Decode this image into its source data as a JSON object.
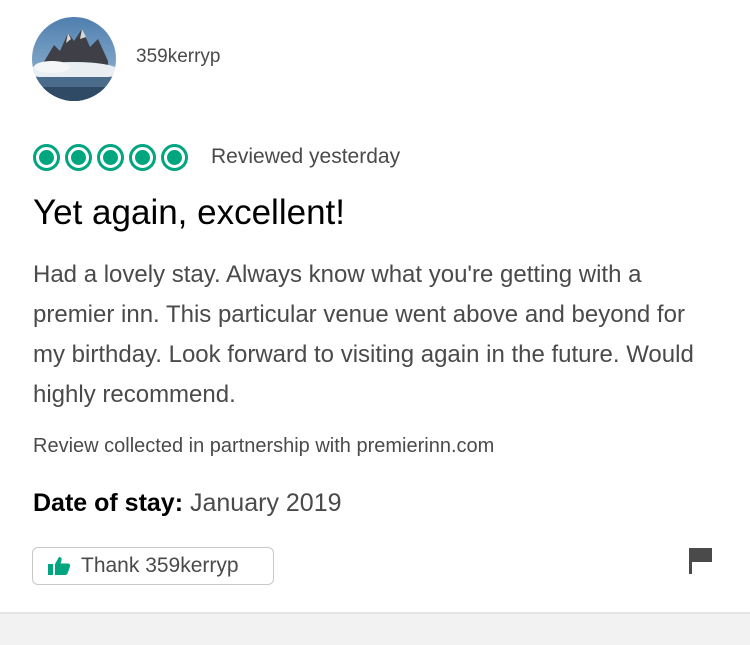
{
  "reviewer": {
    "username": "359kerryp",
    "avatar_icon": "mountain-landscape-avatar"
  },
  "review": {
    "rating": 5,
    "rating_max": 5,
    "rating_color": "#00a680",
    "date_text": "Reviewed yesterday",
    "title": "Yet again, excellent!",
    "body": "Had a lovely stay. Always know what you're getting with a premier inn. This particular venue went above and beyond for my birthday. Look forward to visiting again in the future. Would highly recommend.",
    "collected_text": "Review collected in partnership with premierinn.com",
    "stay_label": "Date of stay:",
    "stay_value": "January 2019"
  },
  "actions": {
    "thank_label": "Thank 359kerryp",
    "thank_icon": "thumbs-up-icon",
    "thumb_color": "#00a680",
    "report_icon": "flag-icon"
  }
}
